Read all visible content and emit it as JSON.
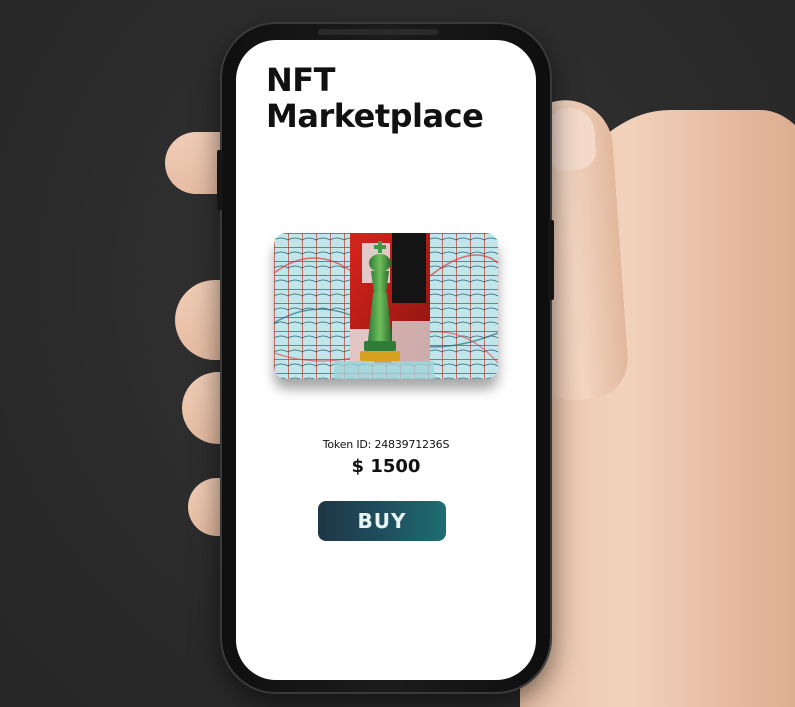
{
  "app": {
    "title_line1": "NFT",
    "title_line2": "Marketplace"
  },
  "nft": {
    "image_icon": "chess-king-icon",
    "token_id_text": "Token ID: 2483971236S",
    "price": "$ 1500"
  },
  "actions": {
    "buy_label": "BUY"
  },
  "colors": {
    "button_start": "#1f3646",
    "button_end": "#1e6e70",
    "screen_bg": "#ffffff",
    "page_bg": "#2e2e2e"
  }
}
